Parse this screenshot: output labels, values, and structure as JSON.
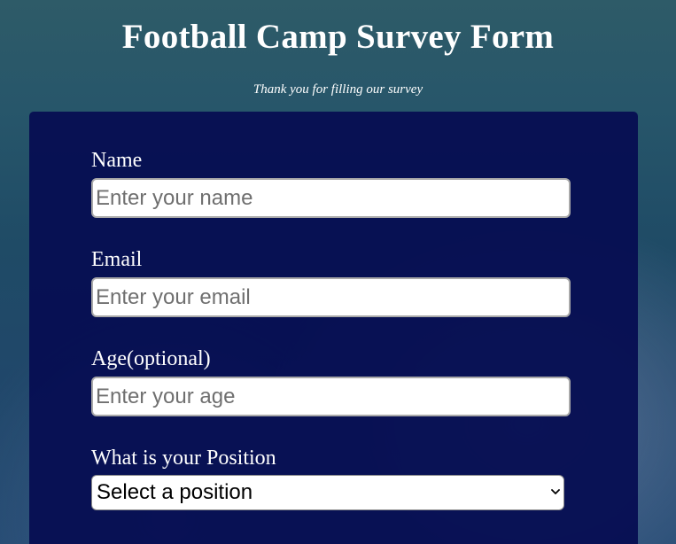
{
  "header": {
    "title": "Football Camp Survey Form",
    "description": "Thank you for filling our survey"
  },
  "form": {
    "name": {
      "label": "Name",
      "placeholder": "Enter your name",
      "value": ""
    },
    "email": {
      "label": "Email",
      "placeholder": "Enter your email",
      "value": ""
    },
    "age": {
      "label": "Age(optional)",
      "placeholder": "Enter your age",
      "value": ""
    },
    "position": {
      "label": "What is your Position",
      "selected": "Select a position"
    }
  },
  "icons": {
    "select_arrow": "chevron-down-icon"
  }
}
